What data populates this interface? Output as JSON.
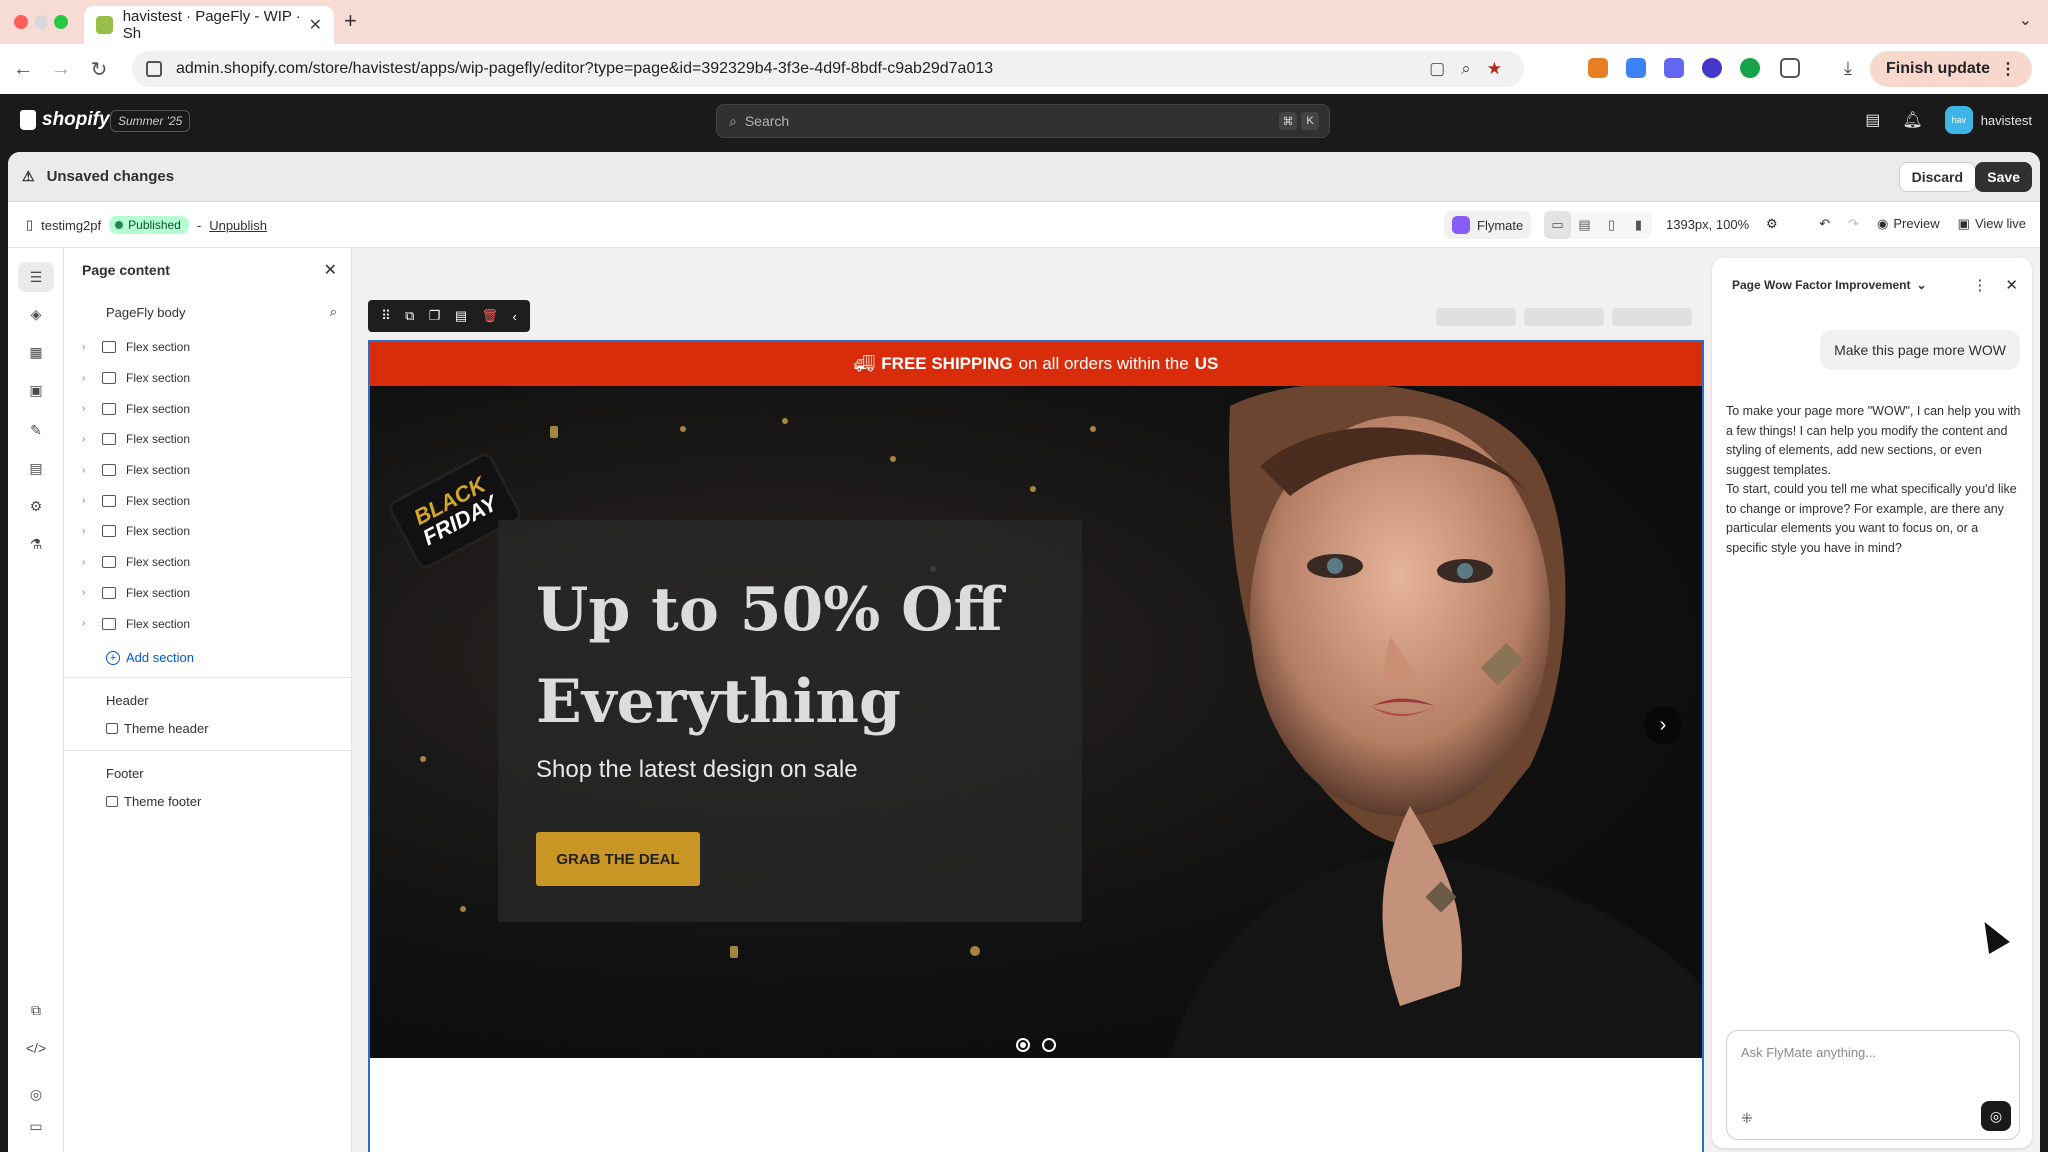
{
  "browser": {
    "tab_title": "havistest · PageFly - WIP · Sh",
    "tab_close": "✕",
    "new_tab": "+",
    "url": "admin.shopify.com/store/havistest/apps/wip-pagefly/editor?type=page&id=392329b4-3f3e-4d9f-8bdf-c9ab29d7a013",
    "finish_update": "Finish update",
    "icons": [
      "back-icon",
      "forward-icon",
      "reload-icon",
      "site-info-icon",
      "screenshot-icon",
      "zoom-icon",
      "bookmark-star-icon",
      "extensions-icon",
      "download-icon",
      "profile-icon",
      "tab-list-icon"
    ],
    "colors": {
      "tabbar": "#f6dcd4",
      "finish": "#f8d7cc"
    }
  },
  "shopify": {
    "logo": "shopify",
    "edition_badge": "Summer '25",
    "search_placeholder": "Search",
    "shortcut_keys": [
      "⌘",
      "K"
    ],
    "store_name": "havistest",
    "avatar_initials": "hav"
  },
  "unsaved": {
    "label": "Unsaved changes",
    "discard": "Discard",
    "save": "Save"
  },
  "editor_toolbar": {
    "page_name": "testimg2pf",
    "status": "Published",
    "separator": "-",
    "unpublish": "Unpublish",
    "flymate": "Flymate",
    "zoom_readout": "1393px, 100%",
    "preview": "Preview",
    "view_live": "View live",
    "devices": [
      "desktop-icon",
      "laptop-icon",
      "tablet-icon",
      "mobile-icon"
    ],
    "active_device": "desktop-icon"
  },
  "left_rail": {
    "icons": [
      "layers-icon",
      "elements-icon",
      "apps-icon",
      "cms-icon",
      "styles-icon",
      "pages-icon",
      "settings-icon",
      "test-icon",
      "integrations-icon",
      "code-icon",
      "help-icon",
      "chat-icon"
    ]
  },
  "panel": {
    "title": "Page content",
    "body_label": "PageFly body",
    "sections": [
      "Flex section",
      "Flex section",
      "Flex section",
      "Flex section",
      "Flex section",
      "Flex section",
      "Flex section",
      "Flex section",
      "Flex section",
      "Flex section"
    ],
    "add_section": "Add section",
    "header_group": {
      "title": "Header",
      "item": "Theme header"
    },
    "footer_group": {
      "title": "Footer",
      "item": "Theme footer"
    }
  },
  "canvas": {
    "shipping_banner": {
      "prefix_bold": "FREE SHIPPING",
      "middle": "on all orders within the",
      "suffix_bold": "US"
    },
    "hero": {
      "ribbon_line1": "BLACK",
      "ribbon_line2": "FRIDAY",
      "headline": "Up to 50% Off Everything",
      "subheadline": "Shop the latest design on sale",
      "cta": "GRAB THE DEAL",
      "slide_count": 2,
      "active_slide": 1
    },
    "colors": {
      "banner": "#d92c0b",
      "cta": "#c99524",
      "selection": "#2c6ecb"
    }
  },
  "flymate": {
    "conversation_title": "Page Wow Factor Improvement",
    "user_message": "Make this page more WOW",
    "assistant_message_p1": "To make your page more \"WOW\", I can help you with a few things! I can help you modify the content and styling of elements, add new sections, or even suggest templates.",
    "assistant_message_p2": "To start, could you tell me what specifically you'd like to change or improve? For example, are there any particular elements you want to focus on, or a specific style you have in mind?",
    "input_placeholder": "Ask FlyMate anything..."
  }
}
